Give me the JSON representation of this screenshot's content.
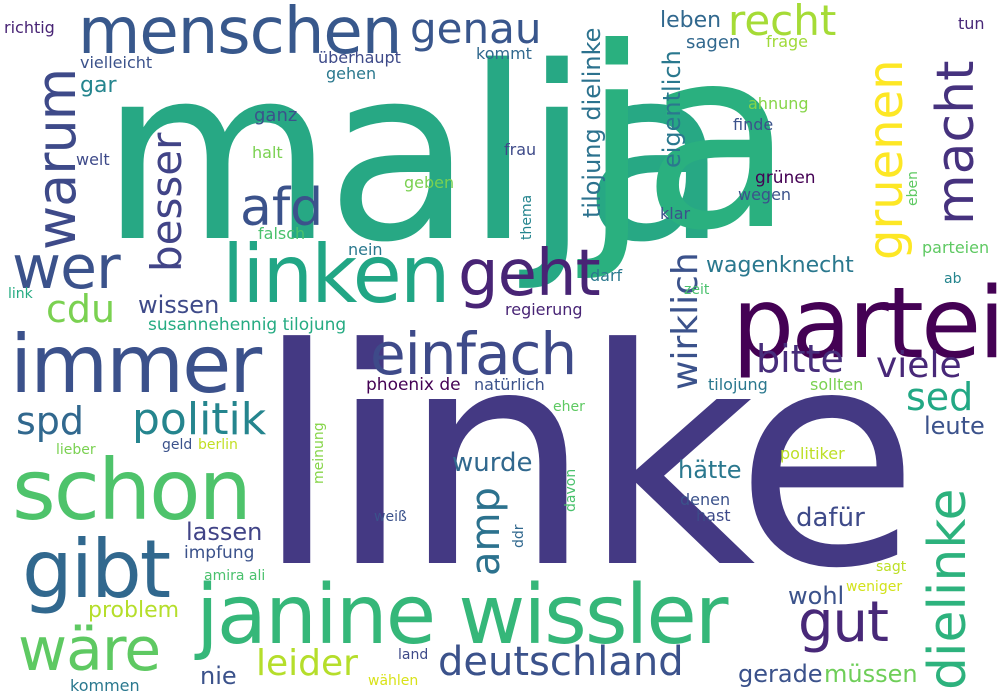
{
  "words": [
    {
      "text": "malja",
      "color": "#27a884"
    },
    {
      "text": "linke",
      "color": "#443983"
    },
    {
      "text": "ja",
      "color": "#2ab07f"
    },
    {
      "text": "partei",
      "color": "#440154"
    },
    {
      "text": "janine wissler",
      "color": "#35b779"
    },
    {
      "text": "immer",
      "color": "#3b518b"
    },
    {
      "text": "schon",
      "color": "#4ec36b"
    },
    {
      "text": "linken",
      "color": "#21a685"
    },
    {
      "text": "gibt",
      "color": "#31688e"
    },
    {
      "text": "menschen",
      "color": "#38588c"
    },
    {
      "text": "einfach",
      "color": "#3e4a89"
    },
    {
      "text": "geht",
      "color": "#482475"
    },
    {
      "text": "wer",
      "color": "#3b528b"
    },
    {
      "text": "warum",
      "color": "#3e4a89"
    },
    {
      "text": "afd",
      "color": "#3b528b"
    },
    {
      "text": "besser",
      "color": "#414487"
    },
    {
      "text": "gruenen",
      "color": "#fde725"
    },
    {
      "text": "macht",
      "color": "#46327e"
    },
    {
      "text": "recht",
      "color": "#a5db36"
    },
    {
      "text": "genau",
      "color": "#39568c"
    },
    {
      "text": "deutschland",
      "color": "#3b528b"
    },
    {
      "text": "gut",
      "color": "#482878"
    },
    {
      "text": "dielinke",
      "color": "#2db27d"
    },
    {
      "text": "wäre",
      "color": "#5ec962"
    },
    {
      "text": "politik",
      "color": "#25858e"
    },
    {
      "text": "spd",
      "color": "#31688e"
    },
    {
      "text": "cdu",
      "color": "#7ad151"
    },
    {
      "text": "leider",
      "color": "#b5de2b"
    },
    {
      "text": "amp",
      "color": "#2c728e"
    },
    {
      "text": "wirklich",
      "color": "#3b528b"
    },
    {
      "text": "bitte",
      "color": "#472d7b"
    },
    {
      "text": "viele",
      "color": "#482878"
    },
    {
      "text": "sed",
      "color": "#22a884"
    },
    {
      "text": "leute",
      "color": "#3b528b"
    },
    {
      "text": "wagenknecht",
      "color": "#2a788e"
    },
    {
      "text": "wurde",
      "color": "#31688e"
    },
    {
      "text": "hätte",
      "color": "#2a788e"
    },
    {
      "text": "dafür",
      "color": "#3e4a89"
    },
    {
      "text": "wohl",
      "color": "#3b528b"
    },
    {
      "text": "gerade",
      "color": "#3b528b"
    },
    {
      "text": "müssen",
      "color": "#6ece58"
    },
    {
      "text": "lassen",
      "color": "#414487"
    },
    {
      "text": "problem",
      "color": "#b5de2b"
    },
    {
      "text": "nie",
      "color": "#3b528b"
    },
    {
      "text": "wissen",
      "color": "#3e4a89"
    },
    {
      "text": "susannehennig tilojung",
      "color": "#25ab82"
    },
    {
      "text": "eigentlich",
      "color": "#2a788e"
    },
    {
      "text": "tilojung dielinke",
      "color": "#2c728e"
    },
    {
      "text": "leben",
      "color": "#31688e"
    },
    {
      "text": "sagen",
      "color": "#31688e"
    },
    {
      "text": "frage",
      "color": "#a0da39"
    },
    {
      "text": "tun",
      "color": "#482878"
    },
    {
      "text": "richtig",
      "color": "#482475"
    },
    {
      "text": "vielleicht",
      "color": "#3b528b"
    },
    {
      "text": "gar",
      "color": "#25858e"
    },
    {
      "text": "überhaupt",
      "color": "#3e4a89"
    },
    {
      "text": "gehen",
      "color": "#2a788e"
    },
    {
      "text": "kommt",
      "color": "#31688e"
    },
    {
      "text": "ganz",
      "color": "#3b528b"
    },
    {
      "text": "halt",
      "color": "#7ad151"
    },
    {
      "text": "welt",
      "color": "#3e4a89"
    },
    {
      "text": "frau",
      "color": "#3e4a89"
    },
    {
      "text": "geben",
      "color": "#7ad151"
    },
    {
      "text": "thema",
      "color": "#25858e"
    },
    {
      "text": "falsch",
      "color": "#4ac16d"
    },
    {
      "text": "nein",
      "color": "#2a788e"
    },
    {
      "text": "link",
      "color": "#25ab82"
    },
    {
      "text": "ahnung",
      "color": "#86d549"
    },
    {
      "text": "finde",
      "color": "#3b528b"
    },
    {
      "text": "grünen",
      "color": "#440154"
    },
    {
      "text": "wegen",
      "color": "#3b528b"
    },
    {
      "text": "eben",
      "color": "#5ec962"
    },
    {
      "text": "klar",
      "color": "#3b528b"
    },
    {
      "text": "parteien",
      "color": "#5ec962"
    },
    {
      "text": "ab",
      "color": "#25858e"
    },
    {
      "text": "zeit",
      "color": "#4ac16d"
    },
    {
      "text": "darf",
      "color": "#2a788e"
    },
    {
      "text": "regierung",
      "color": "#482475"
    },
    {
      "text": "tilojung",
      "color": "#2a788e"
    },
    {
      "text": "sollten",
      "color": "#7ad151"
    },
    {
      "text": "phoenix de",
      "color": "#440154"
    },
    {
      "text": "natürlich",
      "color": "#3b528b"
    },
    {
      "text": "eher",
      "color": "#5ec962"
    },
    {
      "text": "meinung",
      "color": "#86d549"
    },
    {
      "text": "lieber",
      "color": "#7ad151"
    },
    {
      "text": "geld",
      "color": "#3b528b"
    },
    {
      "text": "berlin",
      "color": "#c2df23"
    },
    {
      "text": "politiker",
      "color": "#bddf26"
    },
    {
      "text": "davon",
      "color": "#4ac16d"
    },
    {
      "text": "denen",
      "color": "#3b528b"
    },
    {
      "text": "hast",
      "color": "#3e4a89"
    },
    {
      "text": "weiß",
      "color": "#3b528b"
    },
    {
      "text": "ddr",
      "color": "#31688e"
    },
    {
      "text": "impfung",
      "color": "#3b528b"
    },
    {
      "text": "amira ali",
      "color": "#4ac16d"
    },
    {
      "text": "sagt",
      "color": "#bddf26"
    },
    {
      "text": "weniger",
      "color": "#d2e21b"
    },
    {
      "text": "land",
      "color": "#3e4a89"
    },
    {
      "text": "wählen",
      "color": "#d8e219"
    },
    {
      "text": "kommen",
      "color": "#2a788e"
    }
  ]
}
